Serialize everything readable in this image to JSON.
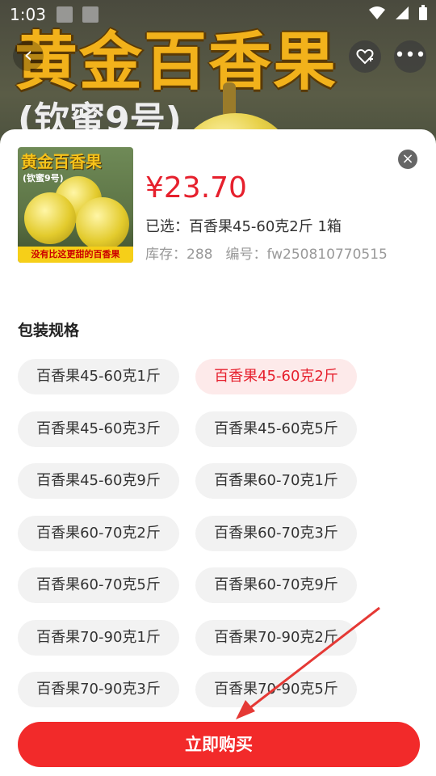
{
  "status_bar": {
    "time": "1:03",
    "icons": [
      "image-icon",
      "a-icon",
      "wifi-icon",
      "signal-icon",
      "battery-icon"
    ]
  },
  "banner": {
    "title": "黄金百香果",
    "subtitle": "(钦蜜9号)"
  },
  "top_actions": {
    "back_icon": "chevron-left-icon",
    "favorite_icon": "heart-plus-icon",
    "more_icon": "more-dots-icon"
  },
  "product": {
    "thumb_title": "黄金百香果",
    "thumb_subtitle": "(钦蜜9号)",
    "thumb_band": "没有比这更甜的百香果",
    "price": "¥23.70",
    "selected": "已选：百香果45-60克2斤 1箱",
    "stock_label": "库存：288",
    "sku_label": "编号：fw250810770515"
  },
  "section": {
    "title": "包装规格"
  },
  "options": [
    {
      "label": "百香果45-60克1斤",
      "selected": false
    },
    {
      "label": "百香果45-60克2斤",
      "selected": true
    },
    {
      "label": "百香果45-60克3斤",
      "selected": false
    },
    {
      "label": "百香果45-60克5斤",
      "selected": false
    },
    {
      "label": "百香果45-60克9斤",
      "selected": false
    },
    {
      "label": "百香果60-70克1斤",
      "selected": false
    },
    {
      "label": "百香果60-70克2斤",
      "selected": false
    },
    {
      "label": "百香果60-70克3斤",
      "selected": false
    },
    {
      "label": "百香果60-70克5斤",
      "selected": false
    },
    {
      "label": "百香果60-70克9斤",
      "selected": false
    },
    {
      "label": "百香果70-90克1斤",
      "selected": false
    },
    {
      "label": "百香果70-90克2斤",
      "selected": false
    },
    {
      "label": "百香果70-90克3斤",
      "selected": false
    },
    {
      "label": "百香果70-90克5斤",
      "selected": false
    }
  ],
  "buy_button": {
    "label": "立即购买"
  },
  "colors": {
    "accent": "#e6202d",
    "buy_button": "#f22a2a",
    "selected_chip_bg": "#fdeaea",
    "annotation_arrow": "#e53935"
  }
}
